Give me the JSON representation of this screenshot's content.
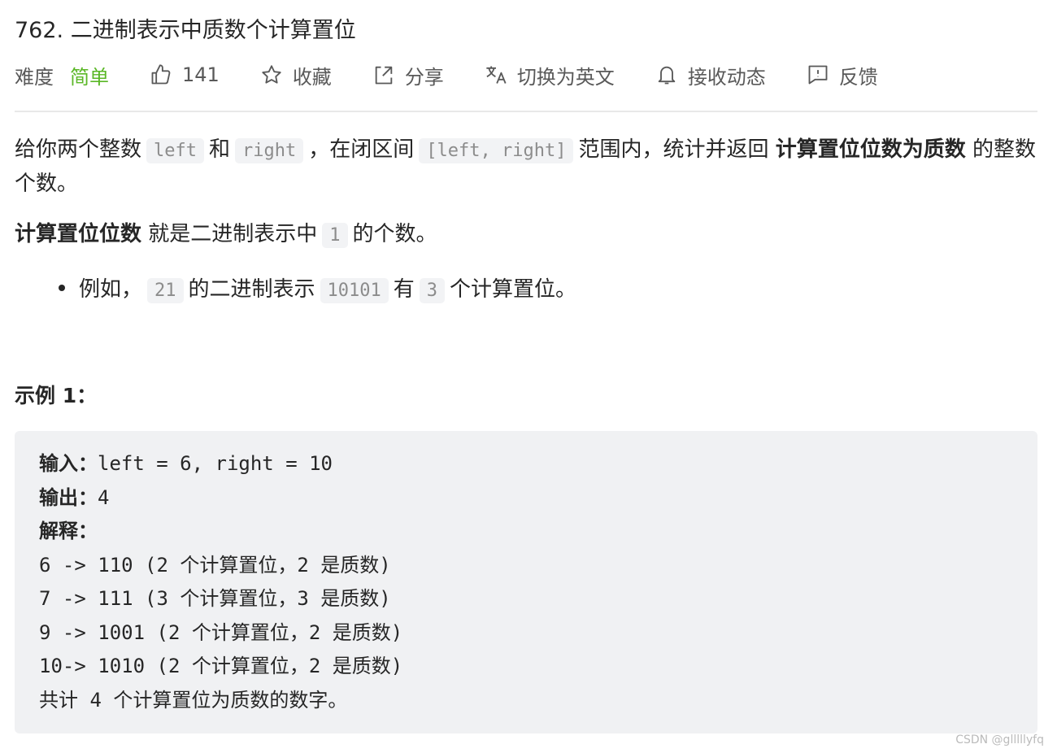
{
  "problem": {
    "title": "762. 二进制表示中质数个计算置位"
  },
  "meta": {
    "difficulty_label": "难度",
    "difficulty": "简单",
    "likes": "141",
    "favorite": "收藏",
    "share": "分享",
    "switch_lang": "切换为英文",
    "subscribe": "接收动态",
    "feedback": "反馈"
  },
  "colors": {
    "easy": "#5ab726",
    "code_bg": "#f2f3f5"
  },
  "description": {
    "p1": {
      "t1": "给你两个整数",
      "c1": "left",
      "t2": "和",
      "c2": "right",
      "t3": "，在闭区间",
      "c3": "[left, right]",
      "t4": "范围内，统计并返回",
      "b1": "计算置位位数为质数",
      "t5": "的整数个数。"
    },
    "p2": {
      "b1": "计算置位位数",
      "t1": "就是二进制表示中",
      "c1": "1",
      "t2": "的个数。"
    },
    "bullet": {
      "t1": "例如，",
      "c1": "21",
      "t2": "的二进制表示",
      "c2": "10101",
      "t3": "有",
      "c3": "3",
      "t4": "个计算置位。"
    }
  },
  "example": {
    "title": "示例 1：",
    "input_label": "输入：",
    "input": "left = 6, right = 10",
    "output_label": "输出：",
    "output": "4",
    "explain_label": "解释：",
    "lines": [
      "6 -> 110 (2 个计算置位，2 是质数)",
      "7 -> 111 (3 个计算置位，3 是质数)",
      "9 -> 1001 (2 个计算置位，2 是质数)",
      "10-> 1010 (2 个计算置位，2 是质数)",
      "共计 4 个计算置位为质数的数字。"
    ]
  },
  "watermark": "CSDN @glllllyfq"
}
